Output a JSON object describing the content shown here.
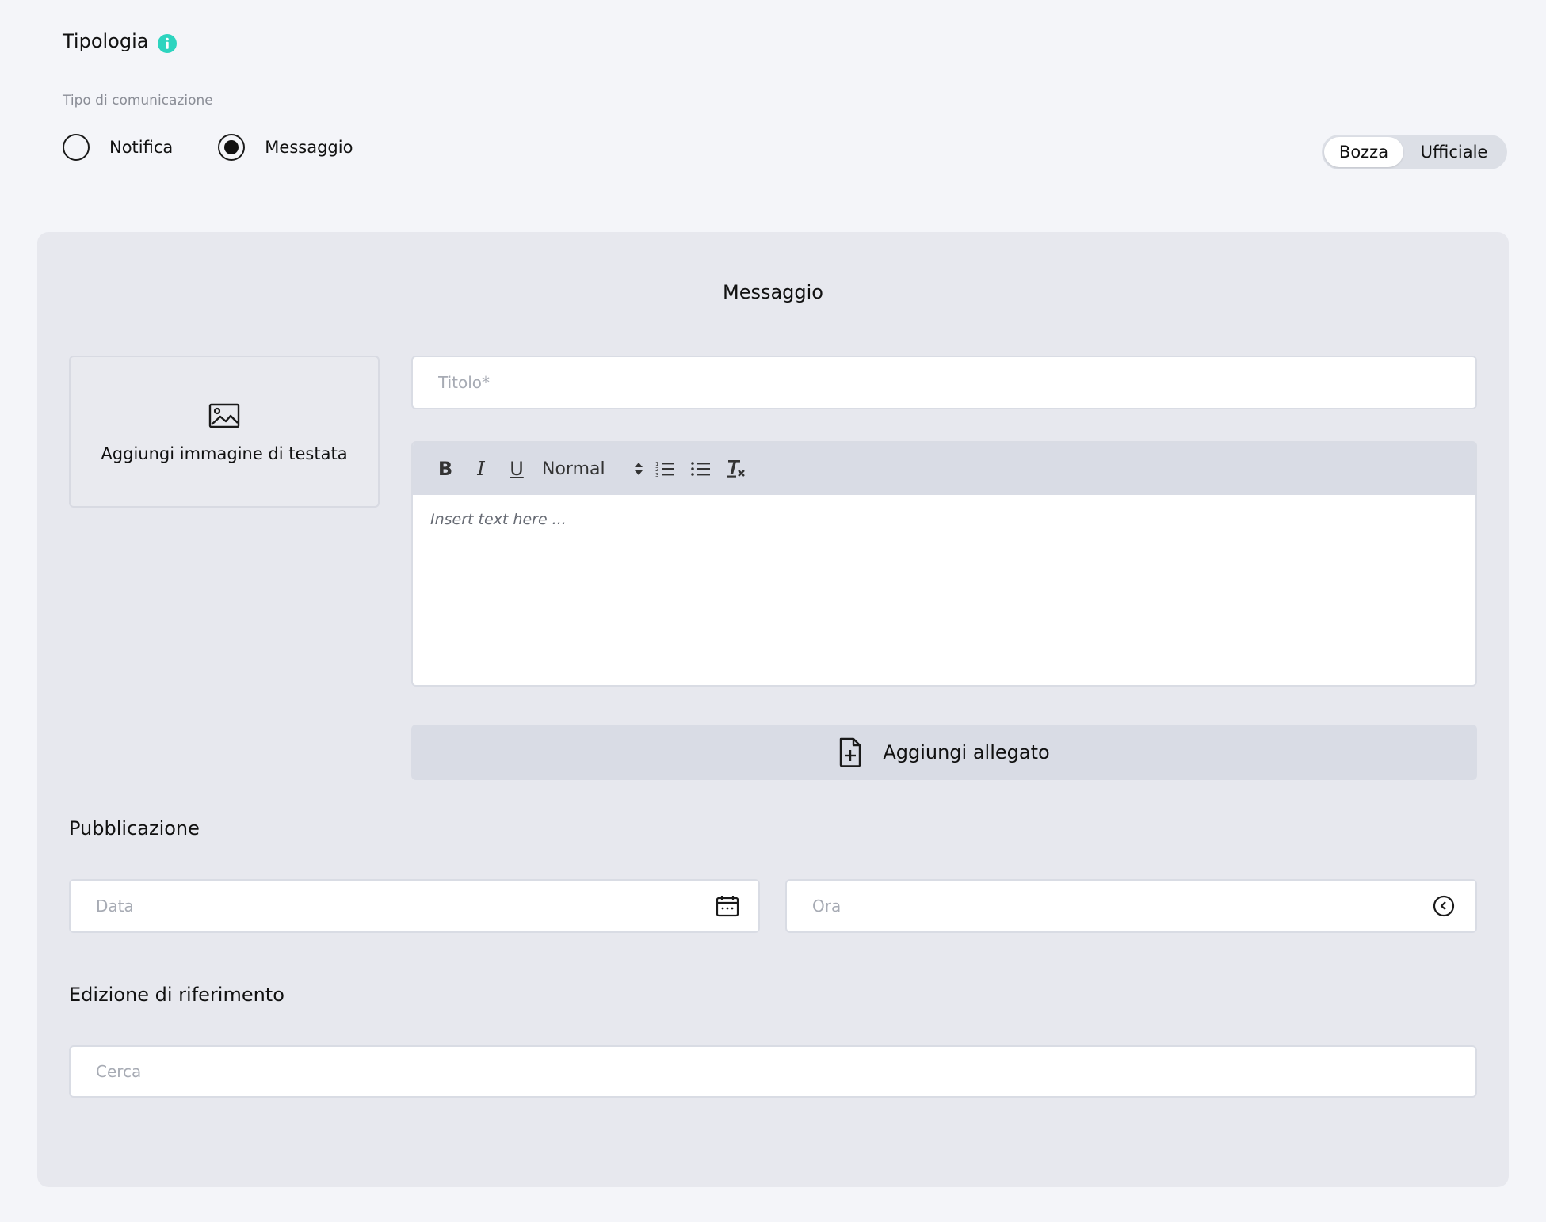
{
  "tipologia": {
    "title": "Tipologia",
    "subtitle": "Tipo di comunicazione",
    "options": [
      {
        "label": "Notifica",
        "selected": false
      },
      {
        "label": "Messaggio",
        "selected": true
      }
    ],
    "accent_color": "#2dd4bf"
  },
  "status_toggle": {
    "options": [
      "Bozza",
      "Ufficiale"
    ],
    "active": "Bozza"
  },
  "message_card": {
    "title": "Messaggio",
    "header_image_label": "Aggiungi immagine di testata",
    "title_placeholder": "Titolo*",
    "editor": {
      "format_select": "Normal",
      "placeholder": "Insert text here ...",
      "tools": [
        "bold",
        "italic",
        "underline",
        "ordered-list",
        "bullet-list",
        "clear-format"
      ]
    },
    "attachment_label": "Aggiungi allegato"
  },
  "publication": {
    "title": "Pubblicazione",
    "date_placeholder": "Data",
    "time_placeholder": "Ora"
  },
  "reference_edition": {
    "title": "Edizione di riferimento",
    "search_placeholder": "Cerca"
  }
}
